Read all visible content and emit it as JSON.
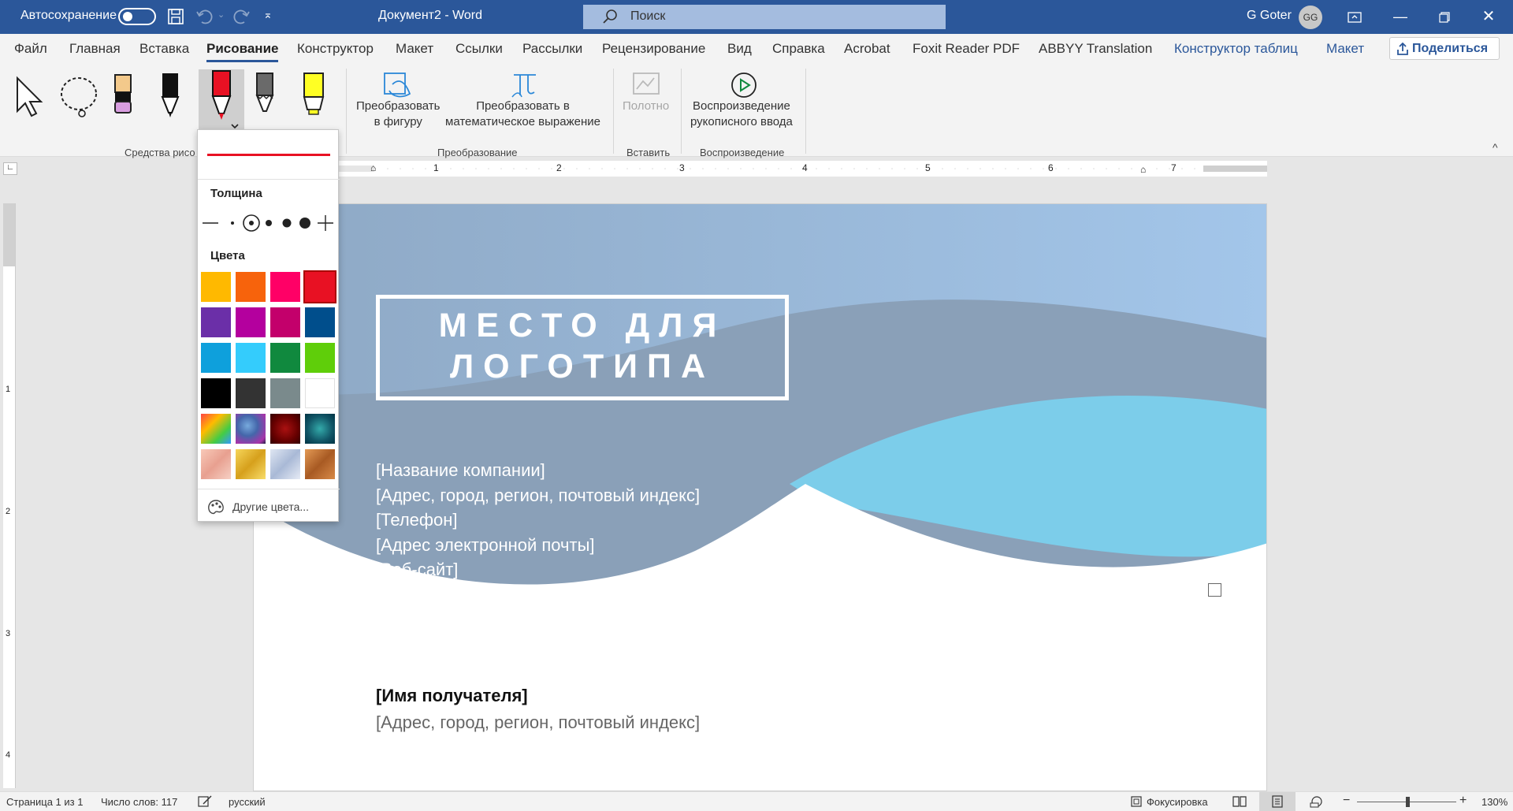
{
  "titlebar": {
    "autosave_label": "Автосохранение",
    "doc_title": "Документ2 - Word",
    "search_placeholder": "Поиск",
    "user_name": "G Goter",
    "user_initials": "GG"
  },
  "tabs": [
    "Файл",
    "Главная",
    "Вставка",
    "Рисование",
    "Конструктор",
    "Макет",
    "Ссылки",
    "Рассылки",
    "Рецензирование",
    "Вид",
    "Справка",
    "Acrobat",
    "Foxit Reader PDF",
    "ABBYY Translation",
    "Конструктор таблиц",
    "Макет"
  ],
  "active_tab": "Рисование",
  "share_label": "Поделиться",
  "ribbon": {
    "group_drawing": "Средства рисо",
    "convert_shape": [
      "Преобразовать",
      "в фигуру"
    ],
    "convert_math": [
      "Преобразовать в",
      "математическое выражение"
    ],
    "group_convert": "Преобразование",
    "canvas_label": "Полотно",
    "group_insert": "Вставить",
    "replay": [
      "Воспроизведение",
      "рукописного ввода"
    ],
    "group_replay": "Воспроизведение"
  },
  "dropdown": {
    "thickness_label": "Толщина",
    "colors_label": "Цвета",
    "more_colors": "Другие цвета...",
    "selected_color": "#e81123",
    "swatches": [
      "#ffb900",
      "#f7630c",
      "#ff0066",
      "#e81123",
      "#6b2fa8",
      "#b4009e",
      "#c3006b",
      "#004e8c",
      "#0ea0dc",
      "#34ccfc",
      "#10893e",
      "#5fce0a",
      "#000000",
      "#333333",
      "#7a8a8c",
      "#ffffff",
      "#d89a2e",
      "#4a52a8",
      "#6b0b0b",
      "#0f6a7a",
      "#f2b6a4",
      "#e6b12a",
      "#b8c6dc",
      "#c9783a"
    ]
  },
  "document": {
    "logo_line1": "МЕСТО ДЛЯ",
    "logo_line2": "ЛОГОТИПА",
    "company": "[Название компании]",
    "address": "[Адрес, город, регион, почтовый индекс]",
    "phone": "[Телефон]",
    "email": "[Адрес электронной почты]",
    "website": "[Веб-сайт]",
    "recipient_name": "[Имя получателя]",
    "recipient_address": "[Адрес, город, регион, почтовый индекс]"
  },
  "ruler_numbers": [
    "1",
    "2",
    "3",
    "4",
    "5",
    "6",
    "7"
  ],
  "ruler_v_numbers": [
    "1",
    "2",
    "3",
    "4"
  ],
  "status": {
    "page": "Страница 1 из 1",
    "words": "Число слов: 117",
    "lang": "русский",
    "focus": "Фокусировка",
    "zoom": "130%"
  },
  "colors": {
    "accent": "#2b579a",
    "ribbon_bg": "#f3f3f3",
    "wave_dark": "#8aa0b8",
    "wave_light": "#7ccdea",
    "header_light": "#9bb8dc"
  }
}
